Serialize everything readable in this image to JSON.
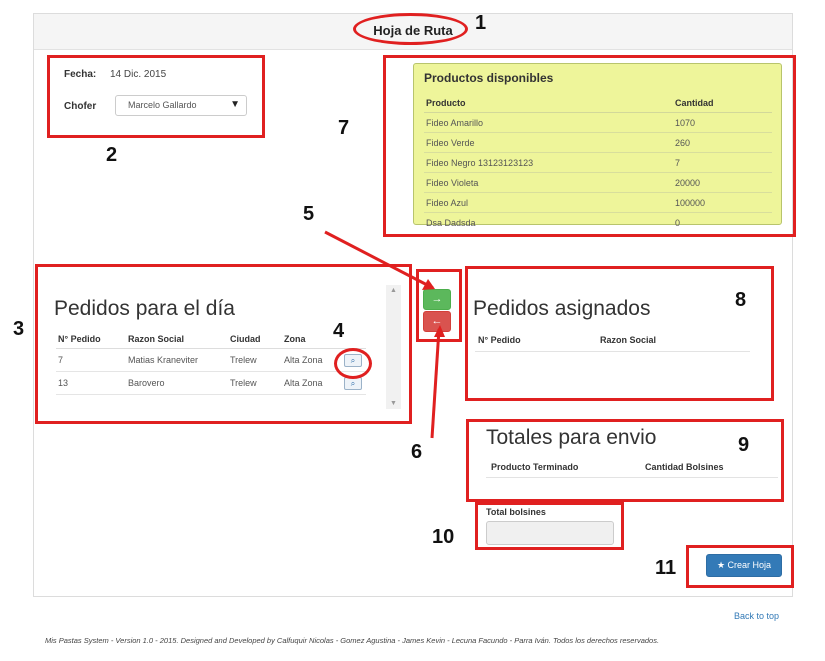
{
  "page": {
    "title": "Hoja de Ruta"
  },
  "form": {
    "fecha_label": "Fecha:",
    "fecha_value": "14 Dic. 2015",
    "chofer_label": "Chofer",
    "chofer_value": "Marcelo Gallardo"
  },
  "productos": {
    "title": "Productos disponibles",
    "columns": [
      "Producto",
      "Cantidad"
    ],
    "rows": [
      [
        "Fideo Amarillo",
        "1070"
      ],
      [
        "Fideo Verde",
        "260"
      ],
      [
        "Fideo Negro 13123123123",
        "7"
      ],
      [
        "Fideo Violeta",
        "20000"
      ],
      [
        "Fideo Azul",
        "100000"
      ],
      [
        "Dsa Dadsda",
        "0"
      ]
    ]
  },
  "pedidos_dia": {
    "title": "Pedidos para el día",
    "columns": [
      "N° Pedido",
      "Razon Social",
      "Ciudad",
      "Zona"
    ],
    "rows": [
      [
        "7",
        "Matias Kraneviter",
        "Trelew",
        "Alta Zona"
      ],
      [
        "13",
        "Barovero",
        "Trelew",
        "Alta Zona"
      ]
    ]
  },
  "transfer": {
    "assign_icon": "→",
    "unassign_icon": "←"
  },
  "pedidos_asignados": {
    "title": "Pedidos asignados",
    "columns": [
      "N° Pedido",
      "Razon Social"
    ]
  },
  "totales": {
    "title": "Totales para envio",
    "columns": [
      "Producto Terminado",
      "Cantidad Bolsines"
    ]
  },
  "total_bolsines": {
    "label": "Total bolsines",
    "value": ""
  },
  "actions": {
    "crear_label": "★ Crear Hoja",
    "back_to_top": "Back to top"
  },
  "footer": {
    "text": "Mis Pastas System - Version 1.0 - 2015. Designed and Developed by Calfuquir Nicolas - Gomez Agustina - James Kevin - Lecuna Facundo - Parra Iván. Todos los derechos reservados."
  },
  "annotations": [
    "1",
    "2",
    "3",
    "4",
    "5",
    "6",
    "7",
    "8",
    "9",
    "10",
    "11"
  ],
  "colors": {
    "annotation": "#e02020",
    "productos_bg": "#eef59a",
    "assign_btn": "#5cb85c",
    "unassign_btn": "#d9534f",
    "primary_btn": "#337ab7"
  }
}
